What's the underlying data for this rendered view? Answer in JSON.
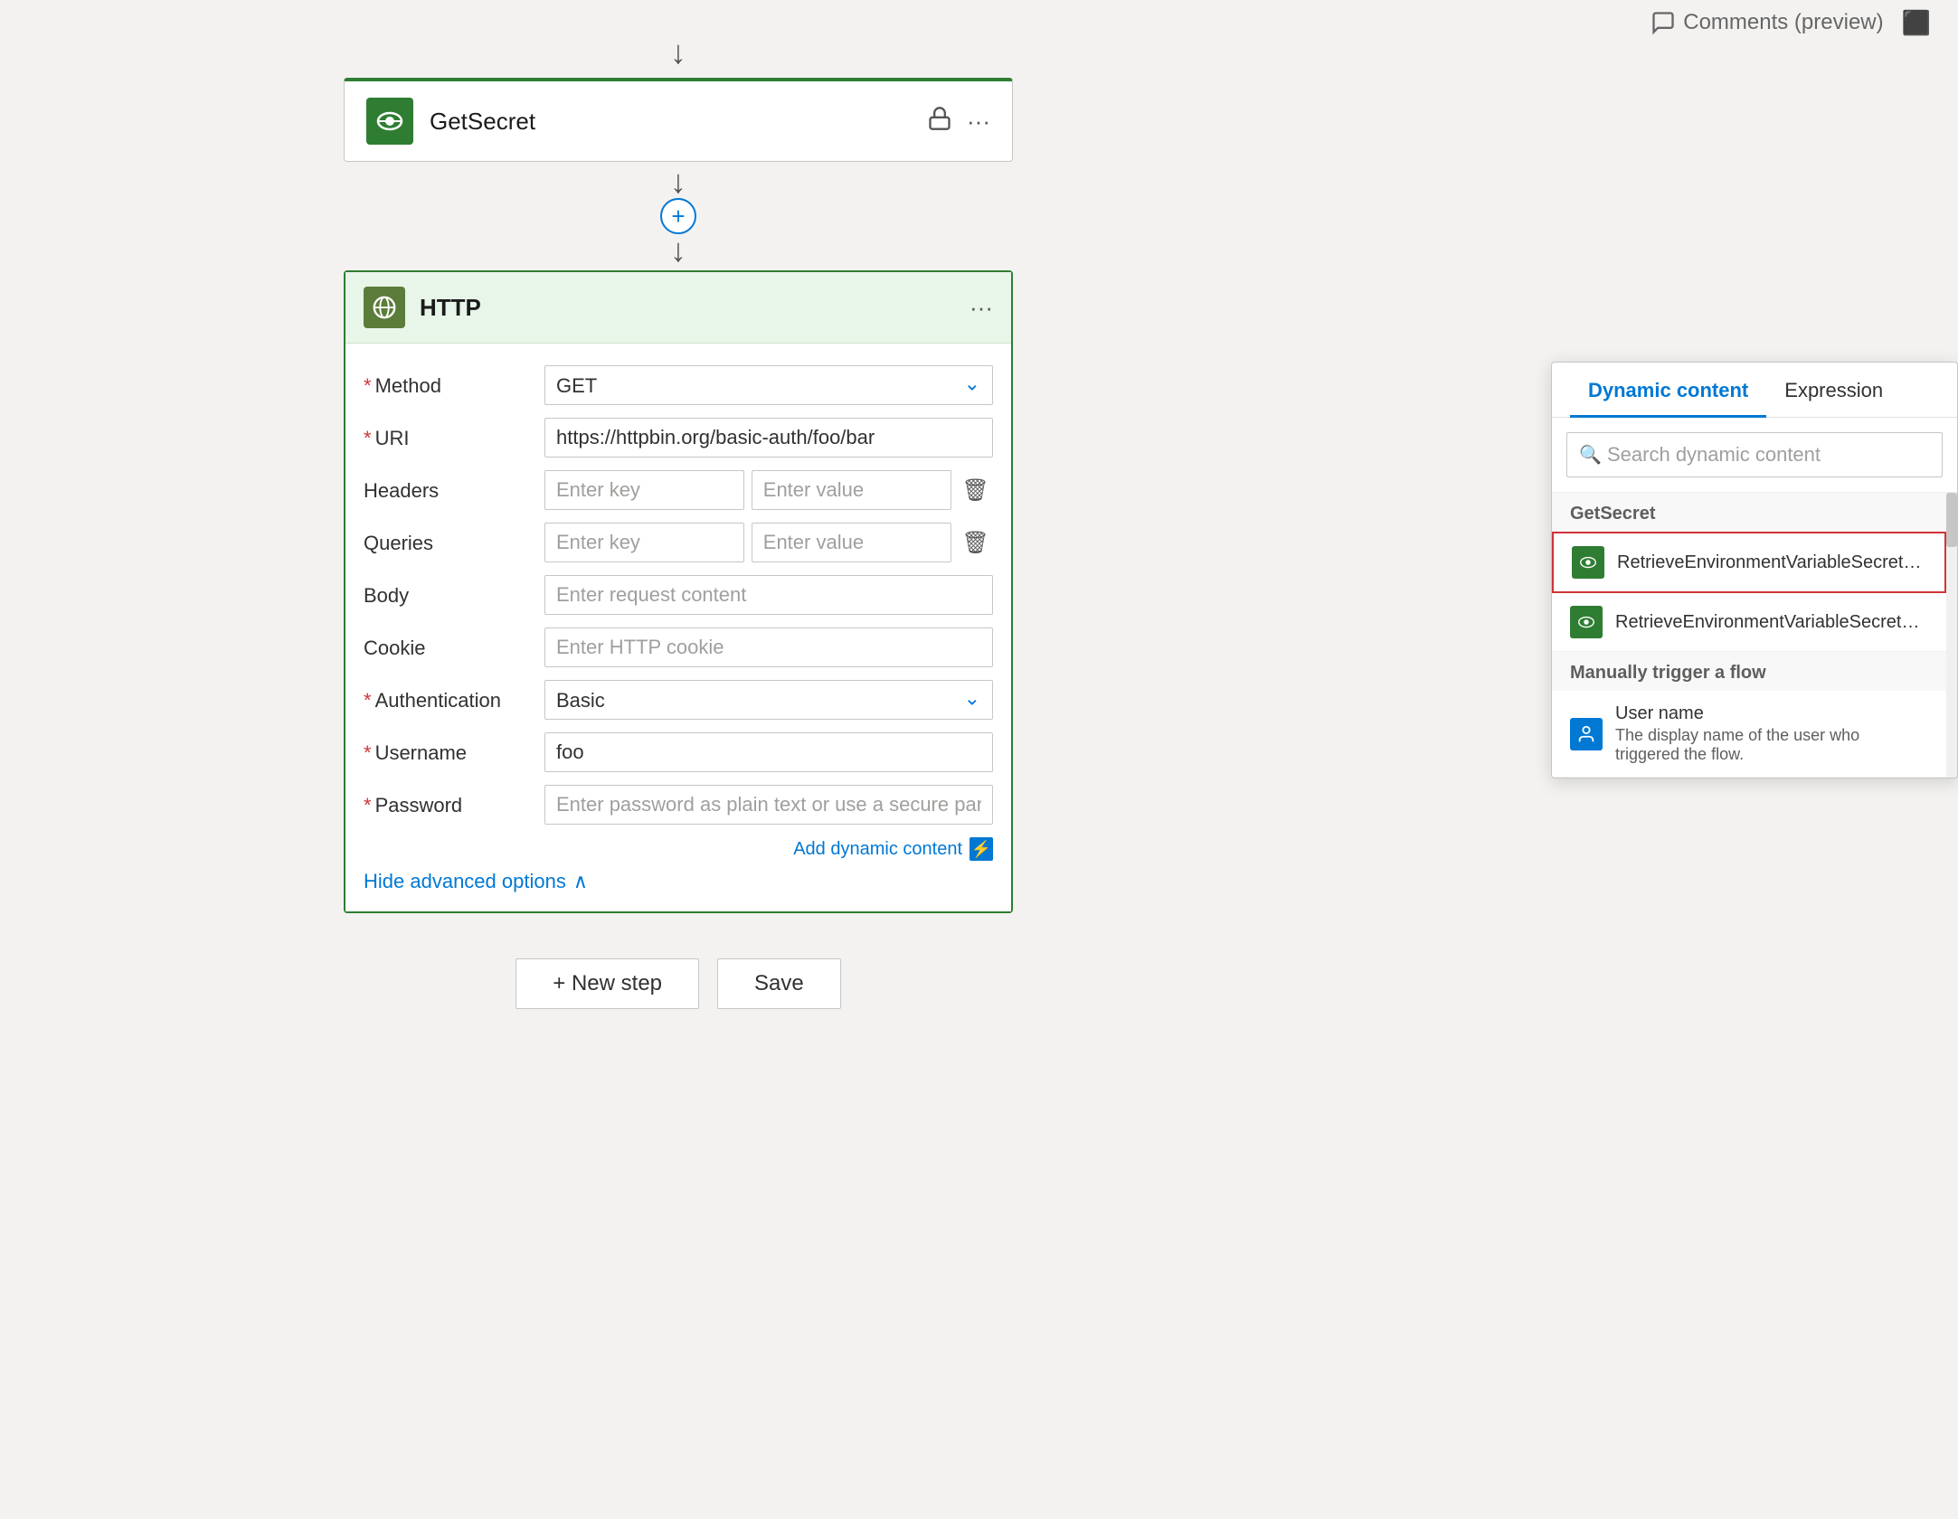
{
  "topbar": {
    "comments_label": "Comments (preview)"
  },
  "get_secret_card": {
    "title": "GetSecret"
  },
  "http_card": {
    "title": "HTTP",
    "method_label": "Method",
    "method_value": "GET",
    "uri_label": "URI",
    "uri_value": "https://httpbin.org/basic-auth/foo/bar",
    "headers_label": "Headers",
    "headers_key_placeholder": "Enter key",
    "headers_value_placeholder": "Enter value",
    "queries_label": "Queries",
    "queries_key_placeholder": "Enter key",
    "queries_value_placeholder": "Enter value",
    "body_label": "Body",
    "body_placeholder": "Enter request content",
    "cookie_label": "Cookie",
    "cookie_placeholder": "Enter HTTP cookie",
    "auth_label": "Authentication",
    "auth_value": "Basic",
    "username_label": "Username",
    "username_value": "foo",
    "password_label": "Password",
    "password_placeholder": "Enter password as plain text or use a secure parameter",
    "add_dynamic_label": "Add dynamic content",
    "hide_advanced_label": "Hide advanced options"
  },
  "bottom_buttons": {
    "new_step": "+ New step",
    "save": "Save"
  },
  "dynamic_panel": {
    "tab1": "Dynamic content",
    "tab2": "Expression",
    "search_placeholder": "Search dynamic content",
    "section1": "GetSecret",
    "item1_text": "RetrieveEnvironmentVariableSecretValueResponse Envi...",
    "item2_text": "RetrieveEnvironmentVariableSecretValueResponse",
    "section2": "Manually trigger a flow",
    "item3_text": "User name",
    "item3_sub": "The display name of the user who triggered the flow."
  }
}
